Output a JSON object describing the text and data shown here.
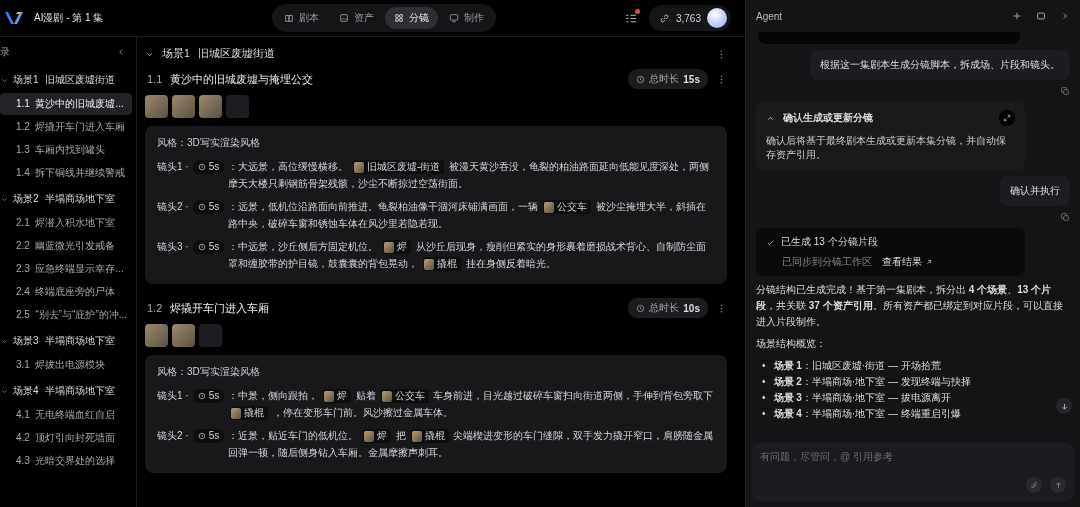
{
  "app": {
    "title": "AI漫剧 - 第 1 集"
  },
  "tabs": [
    {
      "label": "剧本",
      "selected": false
    },
    {
      "label": "资产",
      "selected": false
    },
    {
      "label": "分镜",
      "selected": true
    },
    {
      "label": "制作",
      "selected": false
    }
  ],
  "notifications": {
    "unread": true
  },
  "credits": "3,763",
  "sidebar": {
    "title": "录",
    "scenes": [
      {
        "label": "场景1",
        "title": "旧城区废墟街道",
        "expanded": true,
        "children": [
          {
            "number": "1.1",
            "title": "黄沙中的旧城废墟...",
            "selected": true
          },
          {
            "number": "1.2",
            "title": "烬撬开车门进入车厢",
            "selected": false
          },
          {
            "number": "1.3",
            "title": "车厢内找到罐头",
            "selected": false
          },
          {
            "number": "1.4",
            "title": "拆下铜线并继续警戒",
            "selected": false
          }
        ]
      },
      {
        "label": "场景2",
        "title": "半塌商场地下室",
        "expanded": true,
        "children": [
          {
            "number": "2.1",
            "title": "烬潜入积水地下室",
            "selected": false
          },
          {
            "number": "2.2",
            "title": "幽蓝微光引发戒备",
            "selected": false
          },
          {
            "number": "2.3",
            "title": "应急终端显示幸存...",
            "selected": false
          },
          {
            "number": "2.4",
            "title": "终端底座旁的尸体",
            "selected": false
          },
          {
            "number": "2.5",
            "title": "“别去”与“庇护”的冲...",
            "selected": false
          }
        ]
      },
      {
        "label": "场景3",
        "title": "半塌商场地下室",
        "expanded": true,
        "children": [
          {
            "number": "3.1",
            "title": "烬拔出电源模块",
            "selected": false
          }
        ]
      },
      {
        "label": "场景4",
        "title": "半塌商场地下室",
        "expanded": true,
        "children": [
          {
            "number": "4.1",
            "title": "无电终端血红自启",
            "selected": false
          },
          {
            "number": "4.2",
            "title": "顶灯引向封死墙面",
            "selected": false
          },
          {
            "number": "4.3",
            "title": "光暗交界处的选择",
            "selected": false
          }
        ]
      }
    ]
  },
  "scene": {
    "label": "场景1",
    "title": "旧城区废墟街道",
    "expanded": true,
    "segments": [
      {
        "number": "1.1",
        "title": "黄沙中的旧城废墟与掩埋公交",
        "duration_label": "总时长",
        "duration": "15s",
        "thumbnails": [
          {
            "kind": "photo"
          },
          {
            "kind": "photo"
          },
          {
            "kind": "photo"
          },
          {
            "kind": "dark"
          }
        ],
        "style": "风格：3D写实渲染风格",
        "shots": [
          {
            "label": "镜头1 ·",
            "duration": "5s",
            "parts": [
              {
                "kind": "text",
                "text": "：大远景，高位缓慢横移。"
              },
              {
                "kind": "asset",
                "text": "旧城区废墟-街道"
              },
              {
                "kind": "text",
                "text": "被漫天黄沙吞没，龟裂的柏油路面延向低能见度深处，两侧摩天大楼只剩钢筋骨架残骸，沙尘不断掠过空荡街面。"
              }
            ]
          },
          {
            "label": "镜头2 ·",
            "duration": "5s",
            "parts": [
              {
                "kind": "text",
                "text": "：远景，低机位沿路面向前推进。龟裂柏油像干涸河床铺满画面，一辆"
              },
              {
                "kind": "asset",
                "text": "公交车"
              },
              {
                "kind": "text",
                "text": "被沙尘掩埋大半，斜插在路中央，破碎车窗和锈蚀车体在风沙里若隐若现。"
              }
            ]
          },
          {
            "label": "镜头3 ·",
            "duration": "5s",
            "parts": [
              {
                "kind": "text",
                "text": "：中远景，沙丘侧后方固定机位。"
              },
              {
                "kind": "asset",
                "text": "烬"
              },
              {
                "kind": "text",
                "text": "从沙丘后现身，瘦削但紧实的身形裹着磨损战术背心、自制防尘面罩和缠胶带的护目镜，鼓囊囊的背包晃动，"
              },
              {
                "kind": "asset",
                "text": "撬棍"
              },
              {
                "kind": "text",
                "text": "挂在身侧反着暗光。"
              }
            ]
          }
        ]
      },
      {
        "number": "1.2",
        "title": "烬撬开车门进入车厢",
        "duration_label": "总时长",
        "duration": "10s",
        "thumbnails": [
          {
            "kind": "photo"
          },
          {
            "kind": "photo"
          },
          {
            "kind": "dark"
          }
        ],
        "style": "风格：3D写实渲染风格",
        "shots": [
          {
            "label": "镜头1 ·",
            "duration": "5s",
            "parts": [
              {
                "kind": "text",
                "text": "：中景，侧向跟拍，"
              },
              {
                "kind": "asset",
                "text": "烬"
              },
              {
                "kind": "text",
                "text": "贴着"
              },
              {
                "kind": "asset",
                "text": "公交车"
              },
              {
                "kind": "text",
                "text": "车身前进，目光越过破碎车窗扫向街道两侧，手伸到背包旁取下"
              },
              {
                "kind": "asset",
                "text": "撬棍"
              },
              {
                "kind": "text",
                "text": "，停在变形车门前。风沙擦过金属车体。"
              }
            ]
          },
          {
            "label": "镜头2 ·",
            "duration": "5s",
            "parts": [
              {
                "kind": "text",
                "text": "：近景，贴近车门的低机位。"
              },
              {
                "kind": "asset",
                "text": "烬"
              },
              {
                "kind": "text",
                "text": "把"
              },
              {
                "kind": "asset",
                "text": "撬棍"
              },
              {
                "kind": "text",
                "text": "尖端楔进变形的车门缝隙，双手发力撬开窄口，肩膀随金属回弹一顿，随后侧身钻入车厢。金属摩擦声刺耳。"
              }
            ]
          }
        ]
      }
    ]
  },
  "agent": {
    "title": "Agent",
    "messages": [
      {
        "kind": "user",
        "text": "根据这一集剧本生成分镜脚本，拆成场、片段和镜头。"
      },
      {
        "kind": "confirm",
        "title": "确认生成或更新分镜",
        "expanded": true,
        "body": "确认后将基于最终剧本生成或更新本集分镜，并自动保存资产引用。"
      },
      {
        "kind": "user",
        "text": "确认并执行"
      },
      {
        "kind": "result",
        "title": "已生成 13 个分镜片段",
        "subtitle": "已同步到分镜工作区",
        "link": "查看结果"
      },
      {
        "kind": "text",
        "text": "分镜结构已生成完成！基于第一集剧本，拆分出 **4 个场景**、**13 个片段**，共关联 **37 个资产引用**。所有资产都已绑定到对应片段，可以直接进入片段制作。"
      },
      {
        "kind": "text",
        "text": "场景结构概览："
      },
      {
        "kind": "list",
        "bullet": "•",
        "items": [
          "**场景 1**：旧城区废墟·街道 — 开场拾荒",
          "**场景 2**：半塌商场·地下室 — 发现终端与抉择",
          "**场景 3**：半塌商场·地下室 — 拔电源离开",
          "**场景 4**：半塌商场·地下室 — 终端重启引爆"
        ]
      }
    ],
    "input": {
      "placeholder": "有问题，尽管问，@ 引用参考"
    }
  }
}
